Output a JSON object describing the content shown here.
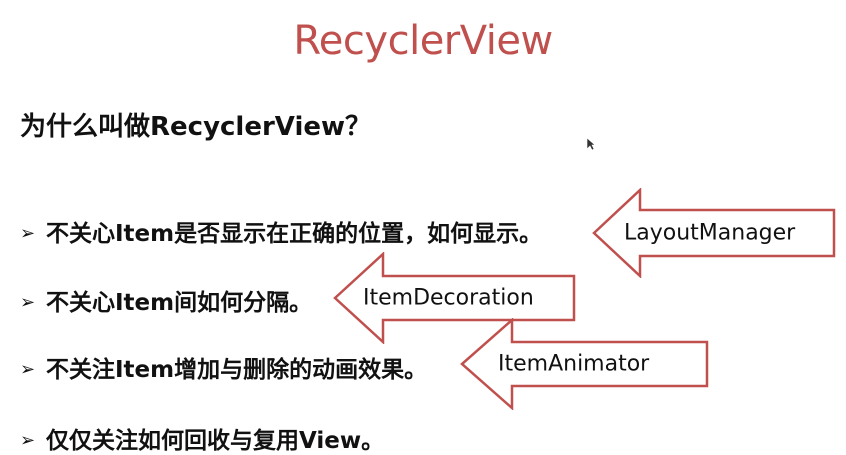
{
  "slide": {
    "title": "RecyclerView",
    "question": "为什么叫做RecyclerView？",
    "bullet_marker": "➢",
    "bullets": [
      "不关心Item是否显示在正确的位置，如何显示。",
      "不关心Item间如何分隔。",
      "不关注Item增加与删除的动画效果。",
      "仅仅关注如何回收与复用View。"
    ],
    "arrows": [
      {
        "label": "LayoutManager"
      },
      {
        "label": "ItemDecoration"
      },
      {
        "label": "ItemAnimator"
      }
    ]
  },
  "colors": {
    "title": "#c0504d",
    "arrow_stroke": "#c0504d",
    "arrow_fill": "#ffffff",
    "text": "#111111"
  },
  "icons": {
    "cursor": "mouse-pointer-icon"
  }
}
